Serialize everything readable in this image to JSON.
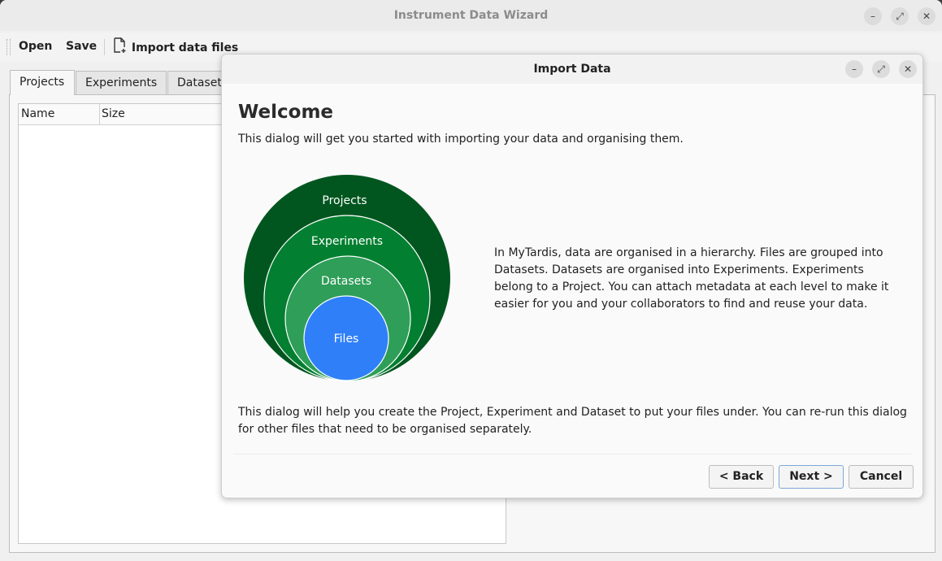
{
  "window": {
    "title": "Instrument Data Wizard"
  },
  "toolbar": {
    "open_label": "Open",
    "save_label": "Save",
    "import_label": "Import data files"
  },
  "tabs": [
    {
      "label": "Projects"
    },
    {
      "label": "Experiments"
    },
    {
      "label": "Dataset"
    }
  ],
  "tree": {
    "columns": [
      "Name",
      "Size"
    ]
  },
  "dialog": {
    "title": "Import Data",
    "heading": "Welcome",
    "intro": "This dialog will get you started with importing your data and organising them.",
    "diagram_labels": {
      "projects": "Projects",
      "experiments": "Experiments",
      "datasets": "Datasets",
      "files": "Files"
    },
    "description": "In MyTardis, data are organised in a hierarchy. Files are grouped into Datasets. Datasets are organised into Experiments. Experiments belong to a Project. You can attach metadata at each level to make it easier for you and your collaborators to find and reuse your data.",
    "help": "This dialog will help you create the Project, Experiment and Dataset to put your files under. You can re-run this dialog for other files that need to be organised separately.",
    "buttons": {
      "back": "< Back",
      "next": "Next >",
      "cancel": "Cancel"
    }
  },
  "colors": {
    "projects": "#01561f",
    "experiments": "#027f30",
    "datasets": "#2e9e58",
    "files": "#2f80f8"
  },
  "icons": [
    "minimize-icon",
    "maximize-icon",
    "close-icon",
    "file-import-icon"
  ]
}
